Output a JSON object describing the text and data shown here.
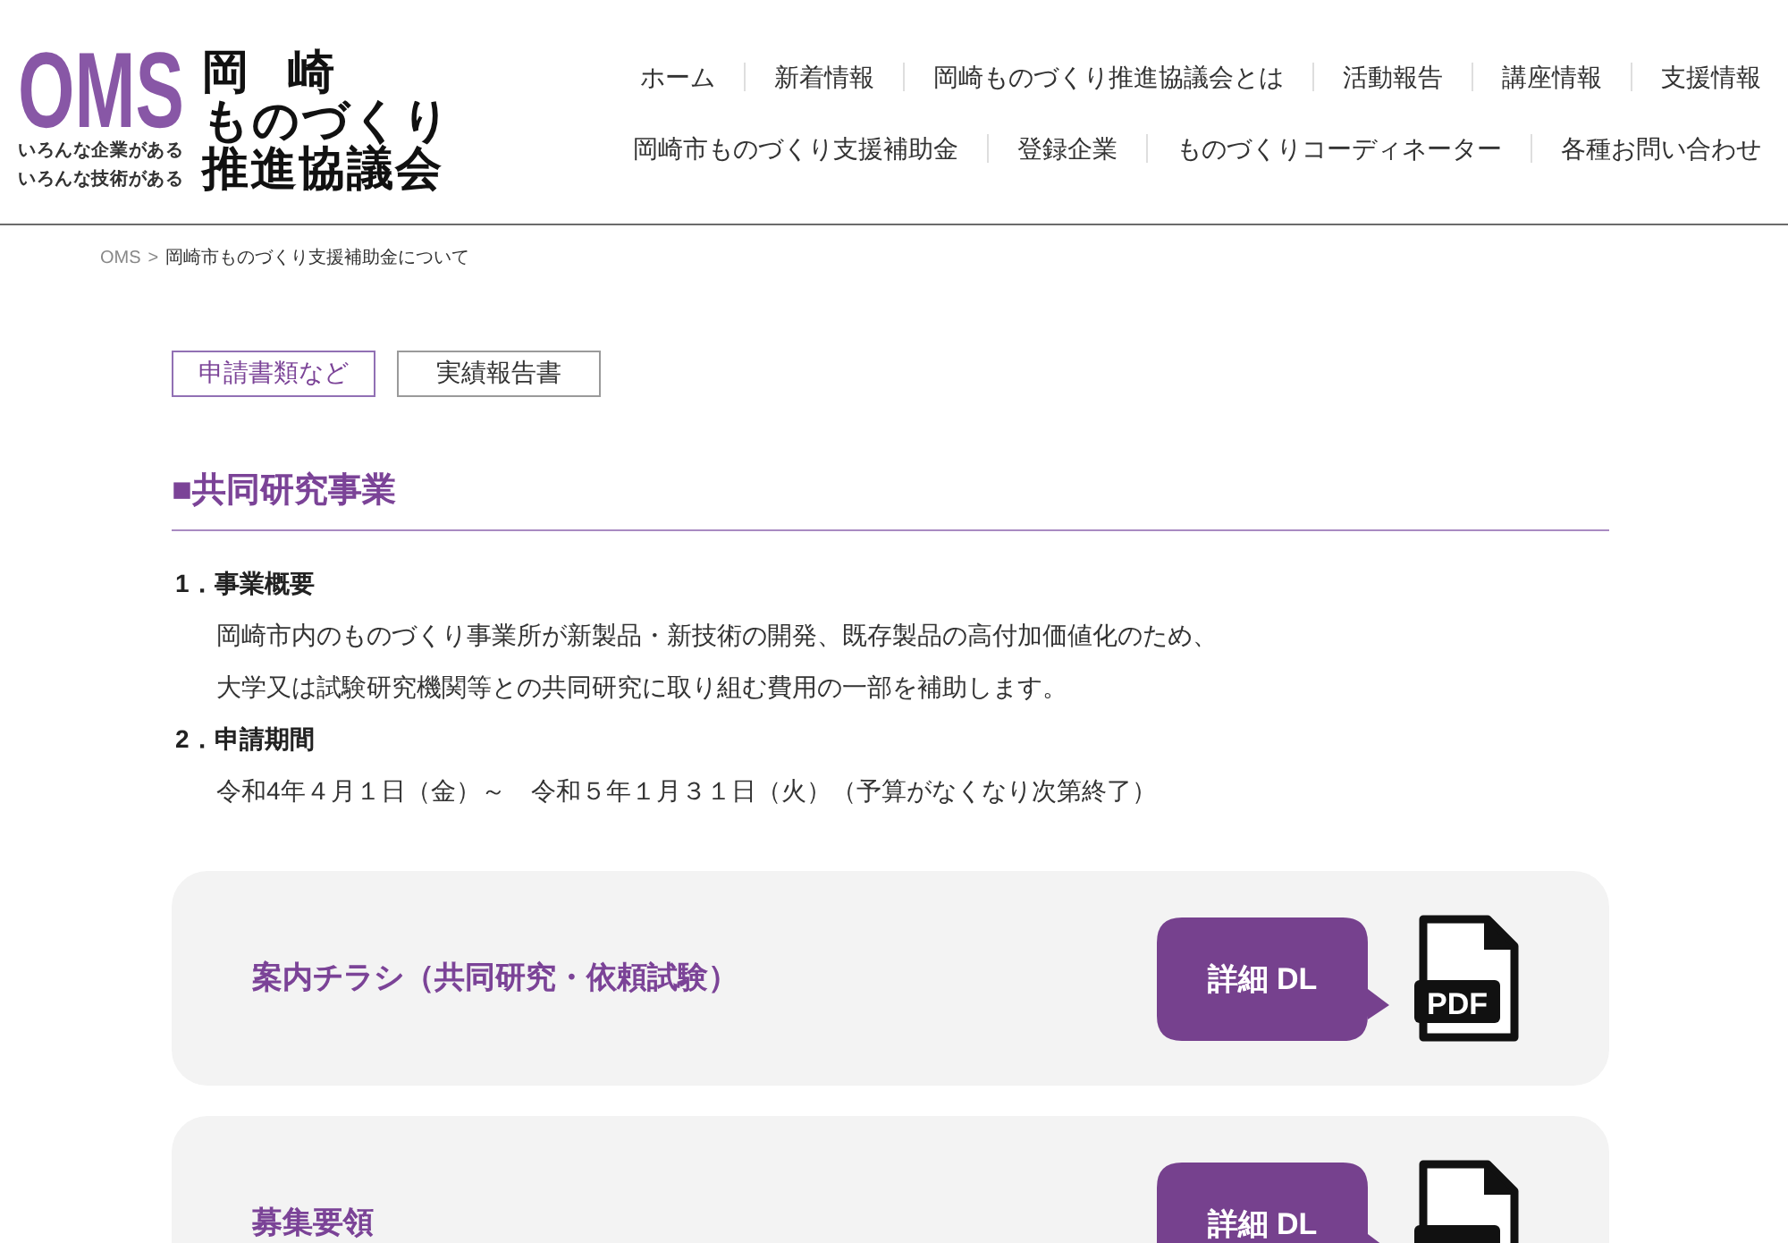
{
  "header": {
    "logo": {
      "wordmark": "OMS",
      "taglines": [
        "いろんな企業がある",
        "いろんな技術がある"
      ],
      "title_lines": [
        "岡崎",
        "ものづくり",
        "推進協議会"
      ]
    },
    "nav": [
      [
        "ホーム",
        "新着情報",
        "岡崎ものづくり推進協議会とは",
        "活動報告",
        "講座情報",
        "支援情報"
      ],
      [
        "岡崎市ものづくり支援補助金",
        "登録企業",
        "ものづくりコーディネーター",
        "各種お問い合わせ"
      ]
    ]
  },
  "breadcrumb": {
    "separator": ">",
    "items": [
      {
        "label": "OMS",
        "kind": "link"
      },
      {
        "label": "岡崎市ものづくり支援補助金について",
        "kind": "current"
      }
    ]
  },
  "tabs": [
    {
      "label": "申請書類など",
      "selected": true
    },
    {
      "label": "実績報告書",
      "selected": false
    }
  ],
  "section": {
    "heading": "■共同研究事業",
    "items": [
      {
        "title": "1．事業概要",
        "lines": [
          "岡崎市内のものづくり事業所が新製品・新技術の開発、既存製品の高付加価値化のため、",
          "大学又は試験研究機関等との共同研究に取り組む費用の一部を補助します。"
        ]
      },
      {
        "title": "2．申請期間",
        "lines": [
          "令和4年４月１日（金）～　令和５年１月３１日（火）（予算がなくなり次第終了）"
        ]
      }
    ]
  },
  "downloads": [
    {
      "title": "案内チラシ（共同研究・依頼試験）",
      "button": "詳細 DL",
      "file_label": "PDF"
    },
    {
      "title": "募集要領",
      "button": "詳細 DL"
    }
  ]
}
